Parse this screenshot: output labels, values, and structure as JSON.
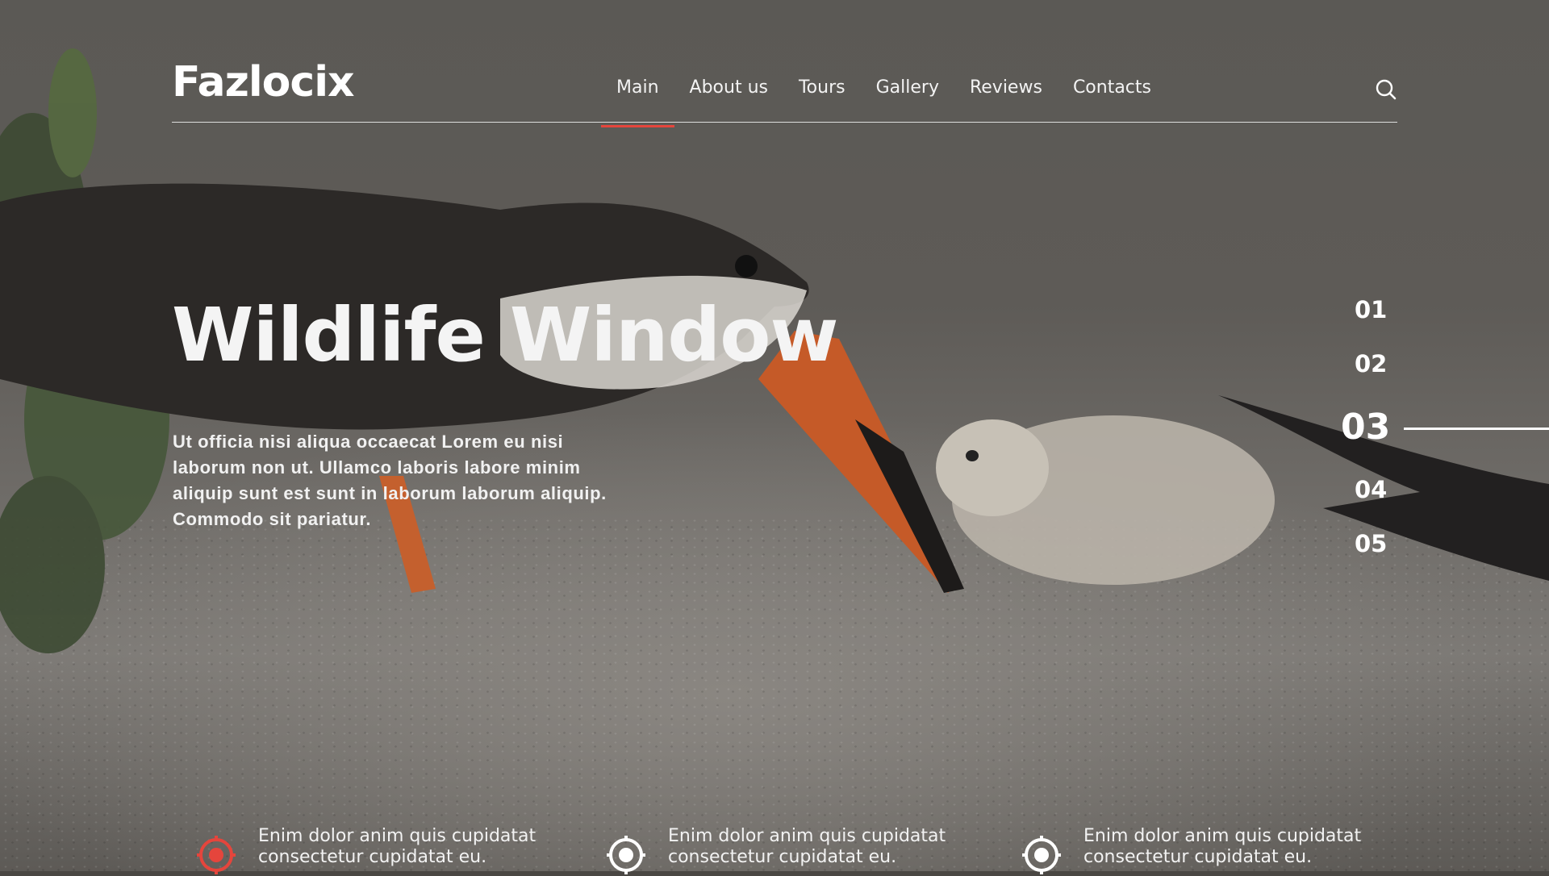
{
  "brand": {
    "name": "Fazlocix"
  },
  "nav": {
    "items": [
      {
        "label": "Main",
        "active": true
      },
      {
        "label": "About us",
        "active": false
      },
      {
        "label": "Tours",
        "active": false
      },
      {
        "label": "Gallery",
        "active": false
      },
      {
        "label": "Reviews",
        "active": false
      },
      {
        "label": "Contacts",
        "active": false
      }
    ],
    "search_icon": "search-icon",
    "active_color": "#e5453c"
  },
  "hero": {
    "title": "Wildlife Window",
    "text": "Ut officia nisi aliqua occaecat Lorem eu nisi laborum non ut. Ullamco laboris labore minim aliquip sunt est sunt in laborum laborum aliquip. Commodo sit pariatur."
  },
  "slides": {
    "numbers": [
      "01",
      "02",
      "03",
      "04",
      "05"
    ],
    "active": "03"
  },
  "features": [
    {
      "text": "Enim dolor anim quis cupidatat consectetur cupidatat eu.",
      "icon": "target-icon",
      "color": "#e5453c"
    },
    {
      "text": "Enim dolor anim quis cupidatat consectetur cupidatat eu.",
      "icon": "target-icon",
      "color": "#ffffff"
    },
    {
      "text": "Enim dolor anim quis cupidatat consectetur cupidatat eu.",
      "icon": "target-icon",
      "color": "#ffffff"
    }
  ]
}
